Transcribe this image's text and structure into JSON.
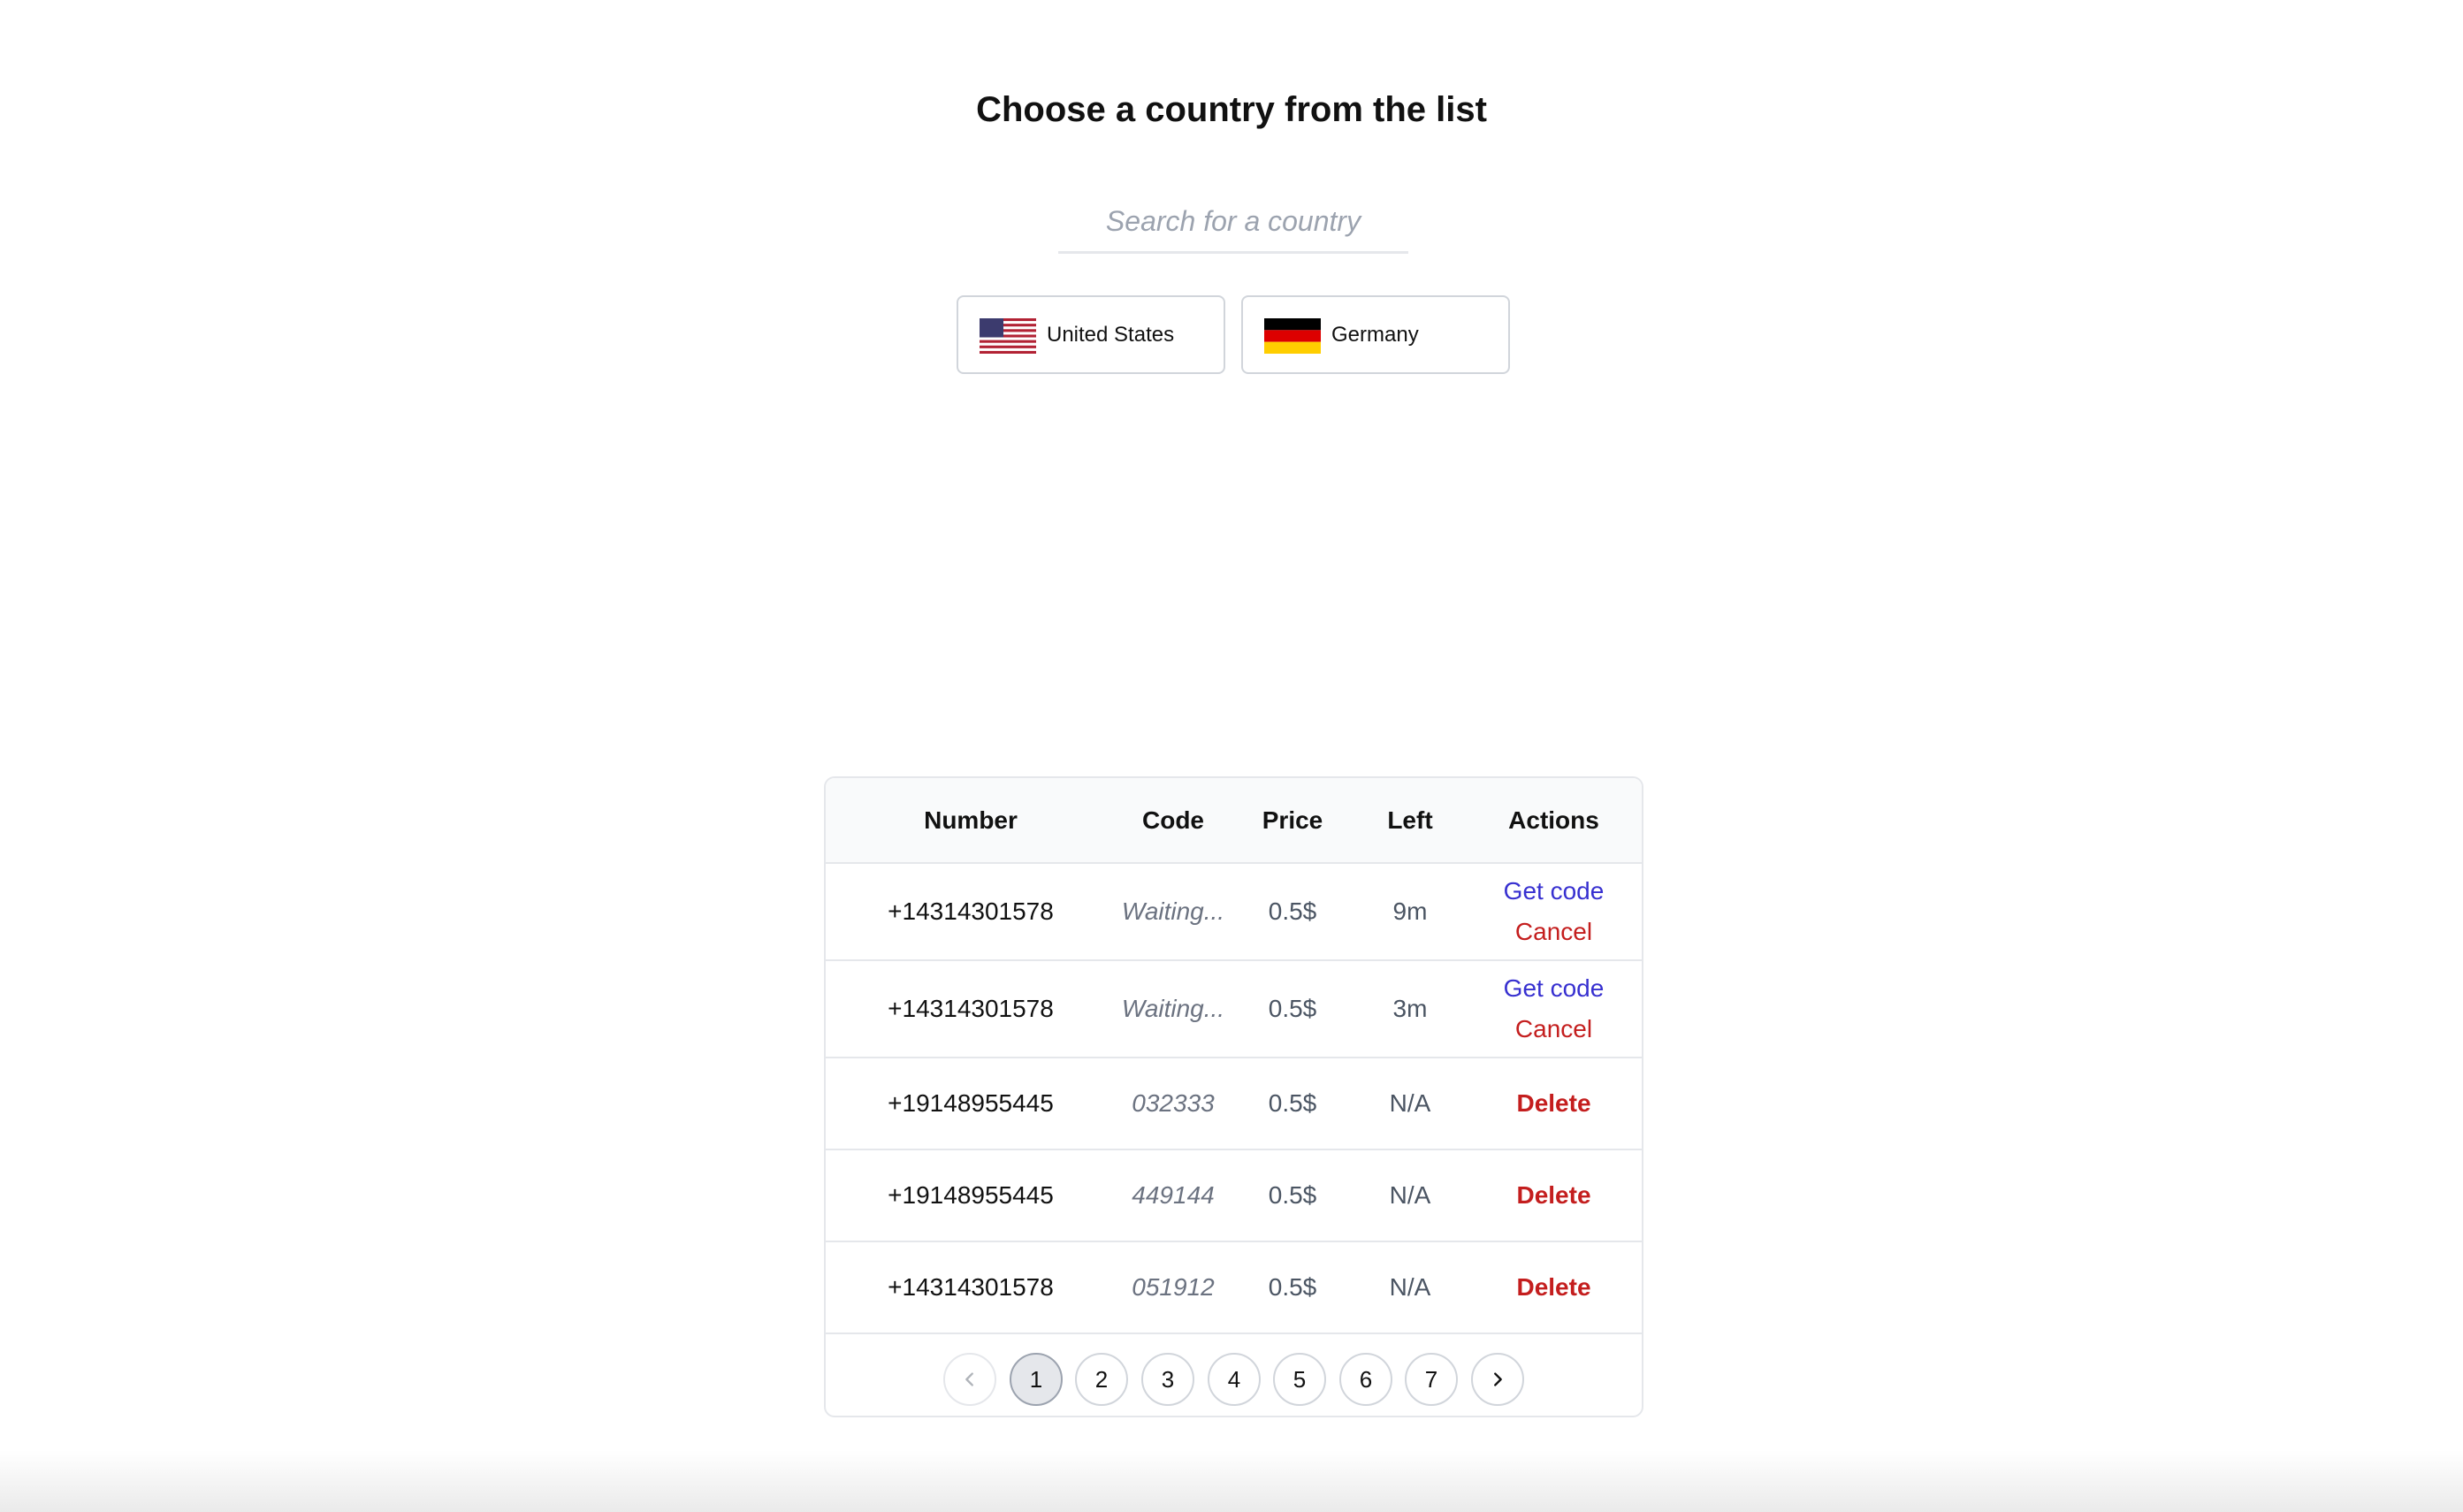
{
  "header": {
    "title": "Choose a country from the list"
  },
  "search": {
    "placeholder": "Search for a country",
    "value": ""
  },
  "countries": [
    {
      "label": "United States",
      "flag": "us-flag-icon"
    },
    {
      "label": "Germany",
      "flag": "de-flag-icon"
    }
  ],
  "table": {
    "headers": {
      "number": "Number",
      "code": "Code",
      "price": "Price",
      "left": "Left",
      "actions": "Actions"
    },
    "rows": [
      {
        "number": "+14314301578",
        "code": "Waiting...",
        "price": "0.5$",
        "left": "9m",
        "actions": [
          "Get code",
          "Cancel"
        ]
      },
      {
        "number": "+14314301578",
        "code": "Waiting...",
        "price": "0.5$",
        "left": "3m",
        "actions": [
          "Get code",
          "Cancel"
        ]
      },
      {
        "number": "+19148955445",
        "code": "032333",
        "price": "0.5$",
        "left": "N/A",
        "actions": [
          "Delete"
        ]
      },
      {
        "number": "+19148955445",
        "code": "449144",
        "price": "0.5$",
        "left": "N/A",
        "actions": [
          "Delete"
        ]
      },
      {
        "number": "+14314301578",
        "code": "051912",
        "price": "0.5$",
        "left": "N/A",
        "actions": [
          "Delete"
        ]
      }
    ]
  },
  "pagination": {
    "current": "1",
    "pages": [
      "1",
      "2",
      "3",
      "4",
      "5",
      "6",
      "7"
    ],
    "prev_icon": "chevron-left-icon",
    "next_icon": "chevron-right-icon"
  },
  "colors": {
    "link_blue": "#3730d0",
    "danger_red": "#c41e1e",
    "border": "#e5e7eb"
  }
}
